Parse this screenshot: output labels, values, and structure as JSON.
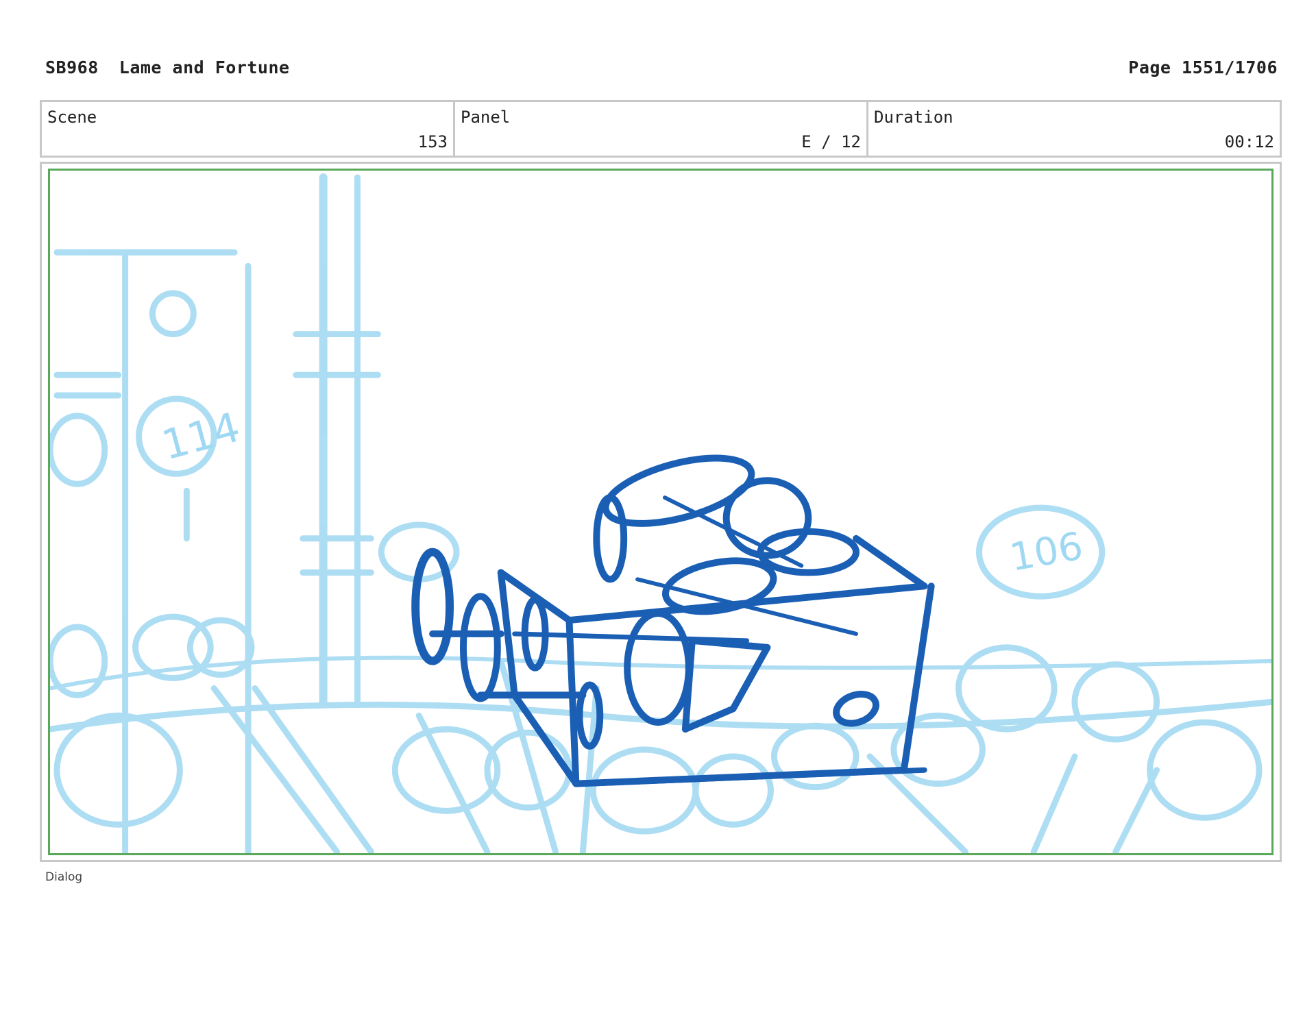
{
  "header": {
    "code": "SB968",
    "title": "Lame and Fortune",
    "page": "Page 1551/1706"
  },
  "info": {
    "scene_label": "Scene",
    "scene_value": "153",
    "panel_label": "Panel",
    "panel_value": "E / 12",
    "duration_label": "Duration",
    "duration_value": "00:12"
  },
  "drawing": {
    "background_color": "#9fd8f2",
    "sketch_color": "#1a5fb4",
    "seat_numbers": [
      "114",
      "106"
    ]
  },
  "footer": {
    "dialog_label": "Dialog"
  }
}
